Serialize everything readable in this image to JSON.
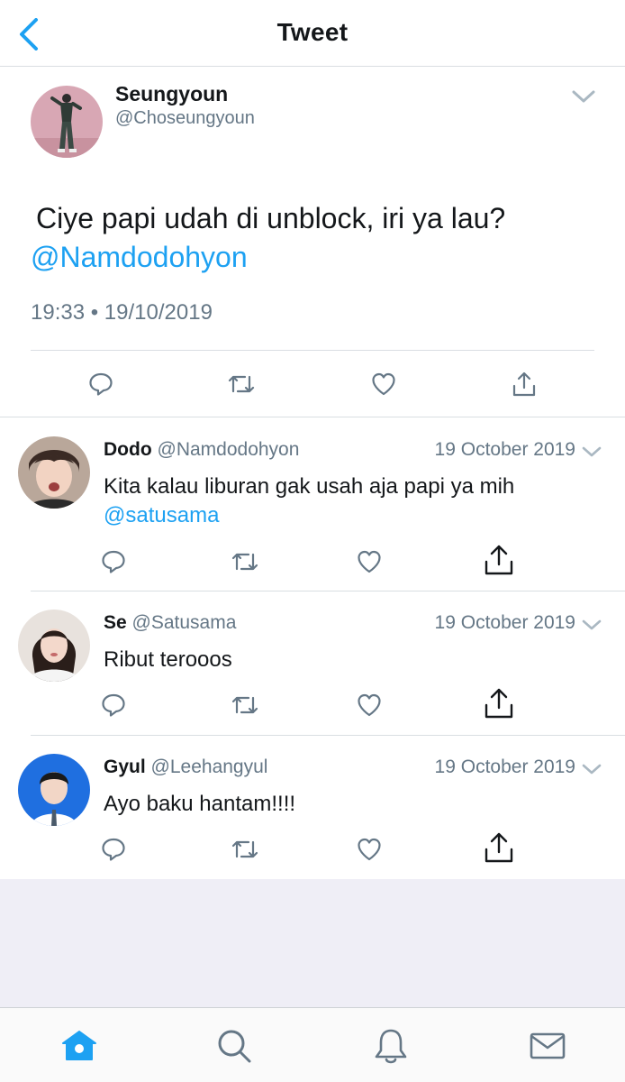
{
  "header": {
    "title": "Tweet"
  },
  "main_tweet": {
    "name": "Seungyoun",
    "handle": "@Choseungyoun",
    "text": "Ciye papi udah di unblock, iri ya lau?",
    "mention": "@Namdodohyon",
    "timestamp": "19:33 • 19/10/2019"
  },
  "replies": [
    {
      "name": "Dodo",
      "handle": "@Namdodohyon",
      "date": "19 October 2019",
      "text": "Kita kalau liburan gak usah aja papi ya mih",
      "mention": "@satusama"
    },
    {
      "name": "Se",
      "handle": "@Satusama",
      "date": "19 October 2019",
      "text": "Ribut terooos",
      "mention": ""
    },
    {
      "name": "Gyul",
      "handle": "@Leehangyul",
      "date": "19 October 2019",
      "text": "Ayo baku hantam!!!!",
      "mention": ""
    }
  ],
  "colors": {
    "accent": "#1da1f2",
    "icon_gray": "#657786",
    "divider": "#d9dee2",
    "empty_bg": "#efeef6"
  },
  "tabbar": {
    "items": [
      "home-icon",
      "search-icon",
      "notifications-icon",
      "messages-icon"
    ],
    "active": "home-icon"
  }
}
